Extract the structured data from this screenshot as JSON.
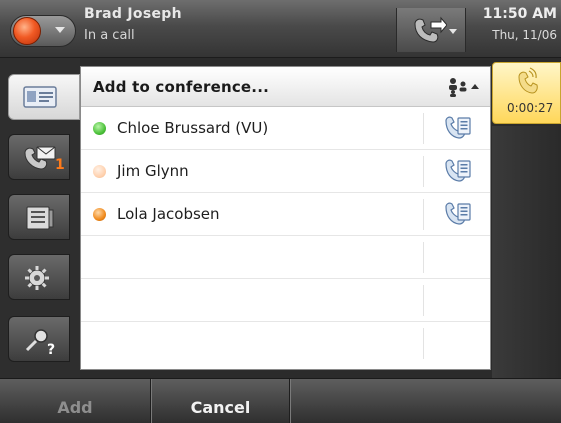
{
  "header": {
    "user_name": "Brad Joseph",
    "user_status": "In a call",
    "time": "11:50 AM",
    "date": "Thu, 11/06"
  },
  "rail": {
    "items": [
      {
        "name": "contacts",
        "icon": "contact-card-icon",
        "active": true
      },
      {
        "name": "voicemail",
        "icon": "voicemail-icon",
        "badge": "1"
      },
      {
        "name": "call-log",
        "icon": "call-log-icon"
      },
      {
        "name": "settings",
        "icon": "gear-icon"
      },
      {
        "name": "search-help",
        "icon": "search-help-icon"
      }
    ]
  },
  "panel": {
    "title": "Add to conference...",
    "contacts": [
      {
        "name": "Chloe Brussard (VU)",
        "presence": "available",
        "presence_color": "#4cc13a"
      },
      {
        "name": "Jim Glynn",
        "presence": "offline",
        "presence_color": "#ffd2b0"
      },
      {
        "name": "Lola Jacobsen",
        "presence": "busy",
        "presence_color": "#f08a1c"
      }
    ]
  },
  "active_call": {
    "timer": "0:00:27"
  },
  "softkeys": {
    "add": "Add",
    "cancel": "Cancel"
  }
}
